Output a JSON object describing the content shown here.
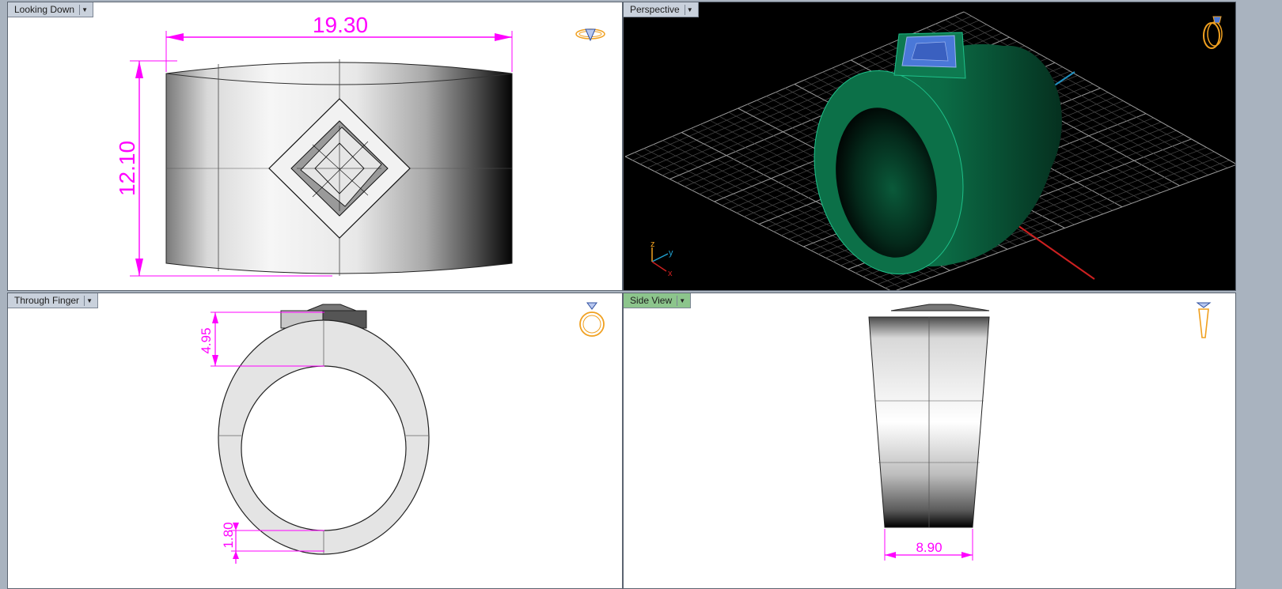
{
  "viewports": {
    "top_left": {
      "label": "Looking Down",
      "dims": {
        "width": "19.30",
        "height": "12.10"
      }
    },
    "top_right": {
      "label": "Perspective",
      "axes": {
        "z": "z",
        "y": "y",
        "x": "x"
      }
    },
    "bottom_left": {
      "label": "Through Finger",
      "dims": {
        "top": "4.95",
        "bottom": "1.80"
      }
    },
    "bottom_right": {
      "label": "Side View",
      "active": true,
      "dims": {
        "width": "8.90"
      }
    }
  },
  "colors": {
    "dimension": "#ff00ff",
    "ring_green": "#0b6b45",
    "gem_blue": "#4a78d8",
    "active_tab": "#8cc58c",
    "icon_orange": "#f0a020"
  },
  "icons": {
    "top_left": "ring-gem-top-icon",
    "top_right": "ring-perspective-icon",
    "bottom_left": "ring-front-icon",
    "bottom_right": "ring-side-icon"
  }
}
